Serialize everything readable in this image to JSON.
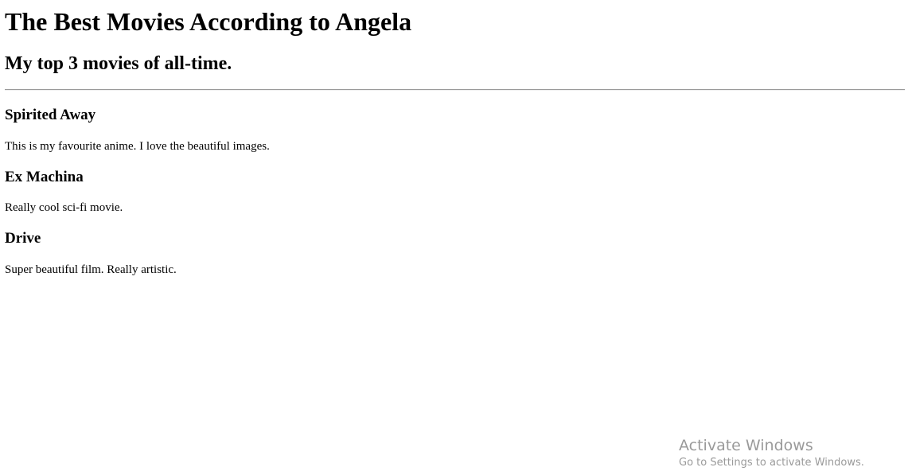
{
  "page": {
    "title": "The Best Movies According to Angela",
    "subtitle": "My top 3 movies of all-time."
  },
  "movies": [
    {
      "title": "Spirited Away",
      "description": "This is my favourite anime. I love the beautiful images."
    },
    {
      "title": "Ex Machina",
      "description": "Really cool sci-fi movie."
    },
    {
      "title": "Drive",
      "description": "Super beautiful film. Really artistic."
    }
  ],
  "watermark": {
    "title": "Activate Windows",
    "text": "Go to Settings to activate Windows."
  }
}
